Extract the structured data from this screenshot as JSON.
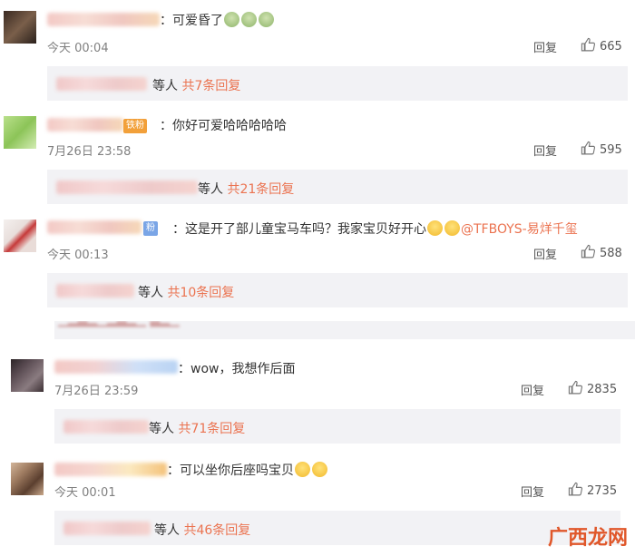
{
  "comments": [
    {
      "text": "：可爱昏了",
      "time": "今天 00:04",
      "reply_label": "回复",
      "likes": "665",
      "replies_prefix": "等人",
      "replies_count": "共7条回复"
    },
    {
      "text": "：你好可爱哈哈哈哈哈",
      "time": "7月26日 23:58",
      "reply_label": "回复",
      "likes": "595",
      "badge": "铁粉",
      "replies_prefix": "等人",
      "replies_count": "共21条回复"
    },
    {
      "text": "：这是开了部儿童宝马车吗？我家宝贝好开心",
      "mention": "@TFBOYS-易烊千玺",
      "time": "今天 00:13",
      "reply_label": "回复",
      "likes": "588",
      "badge": "粉",
      "replies_prefix": "等人",
      "replies_count": "共10条回复"
    },
    {
      "text": "：wow，我想作后面",
      "time": "7月26日 23:59",
      "reply_label": "回复",
      "likes": "2835",
      "replies_prefix": "等人",
      "replies_count": "共71条回复"
    },
    {
      "text": "：可以坐你后座吗宝贝",
      "time": "今天 00:01",
      "reply_label": "回复",
      "likes": "2735",
      "replies_prefix": "等人",
      "replies_count": "共46条回复"
    }
  ],
  "watermark": "广西龙网",
  "colors": {
    "accent": "#eb7350",
    "reply_box": "#f2f2f5",
    "meta_gray": "#808080"
  }
}
